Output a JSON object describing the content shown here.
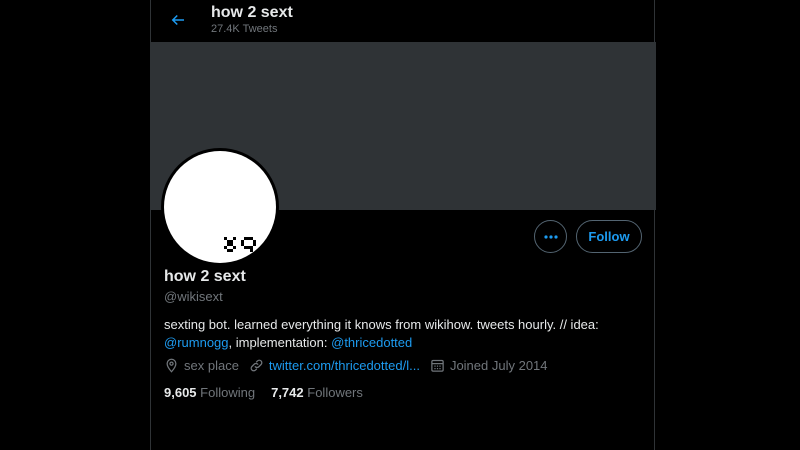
{
  "header": {
    "title": "how 2 sext",
    "tweet_count": "27.4K Tweets"
  },
  "profile": {
    "display_name": "how 2 sext",
    "handle": "@wikisext",
    "bio_text_1": "sexting bot. learned everything it knows from wikihow. tweets hourly. // idea:",
    "bio_mention_1": "@rumnogg",
    "bio_text_2": ", implementation: ",
    "bio_mention_2": "@thricedotted",
    "location": "sex place",
    "website": "twitter.com/thricedotted/l...",
    "joined": "Joined July 2014",
    "following_count": "9,605",
    "following_label": "Following",
    "followers_count": "7,742",
    "followers_label": "Followers"
  },
  "actions": {
    "follow_label": "Follow"
  },
  "colors": {
    "background": "#000000",
    "banner": "#2f3336",
    "accent": "#1d9bf0",
    "secondary_text": "#71767b",
    "primary_text": "#e7e9ea"
  },
  "icons": [
    "back-arrow-icon",
    "more-options-icon",
    "location-icon",
    "link-icon",
    "calendar-icon"
  ]
}
